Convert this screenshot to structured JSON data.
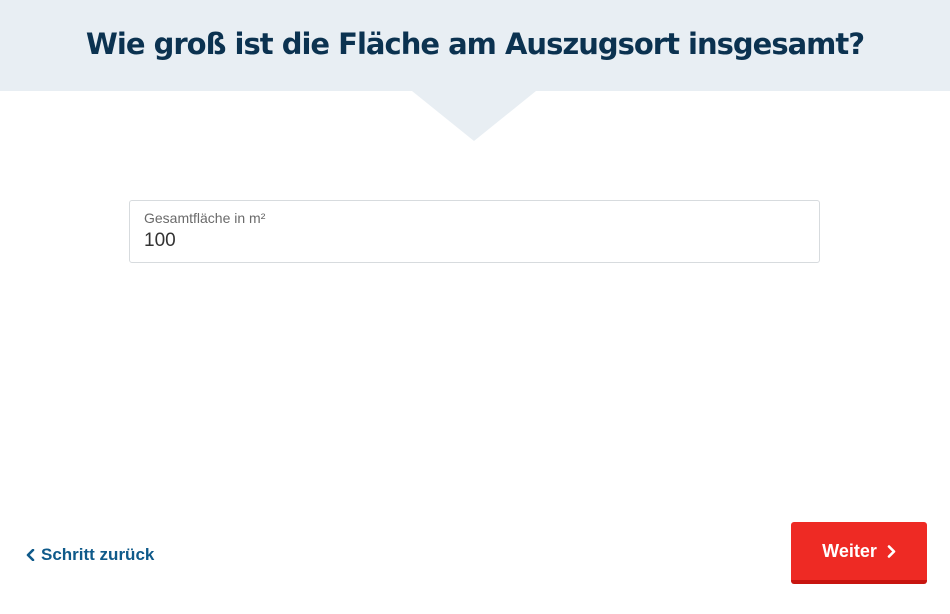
{
  "header": {
    "title": "Wie groß ist die Fläche am Auszugsort insgesamt?",
    "background_color": "#e8eef3",
    "title_color": "#0b3250"
  },
  "form": {
    "area_field": {
      "label": "Gesamtfläche in m²",
      "value": "100"
    }
  },
  "navigation": {
    "back_label": "Schritt zurück",
    "back_icon": "chevron-left-icon",
    "next_label": "Weiter",
    "next_icon": "chevron-right-icon",
    "link_color": "#0f5a8a",
    "button_color": "#ee2a24"
  }
}
